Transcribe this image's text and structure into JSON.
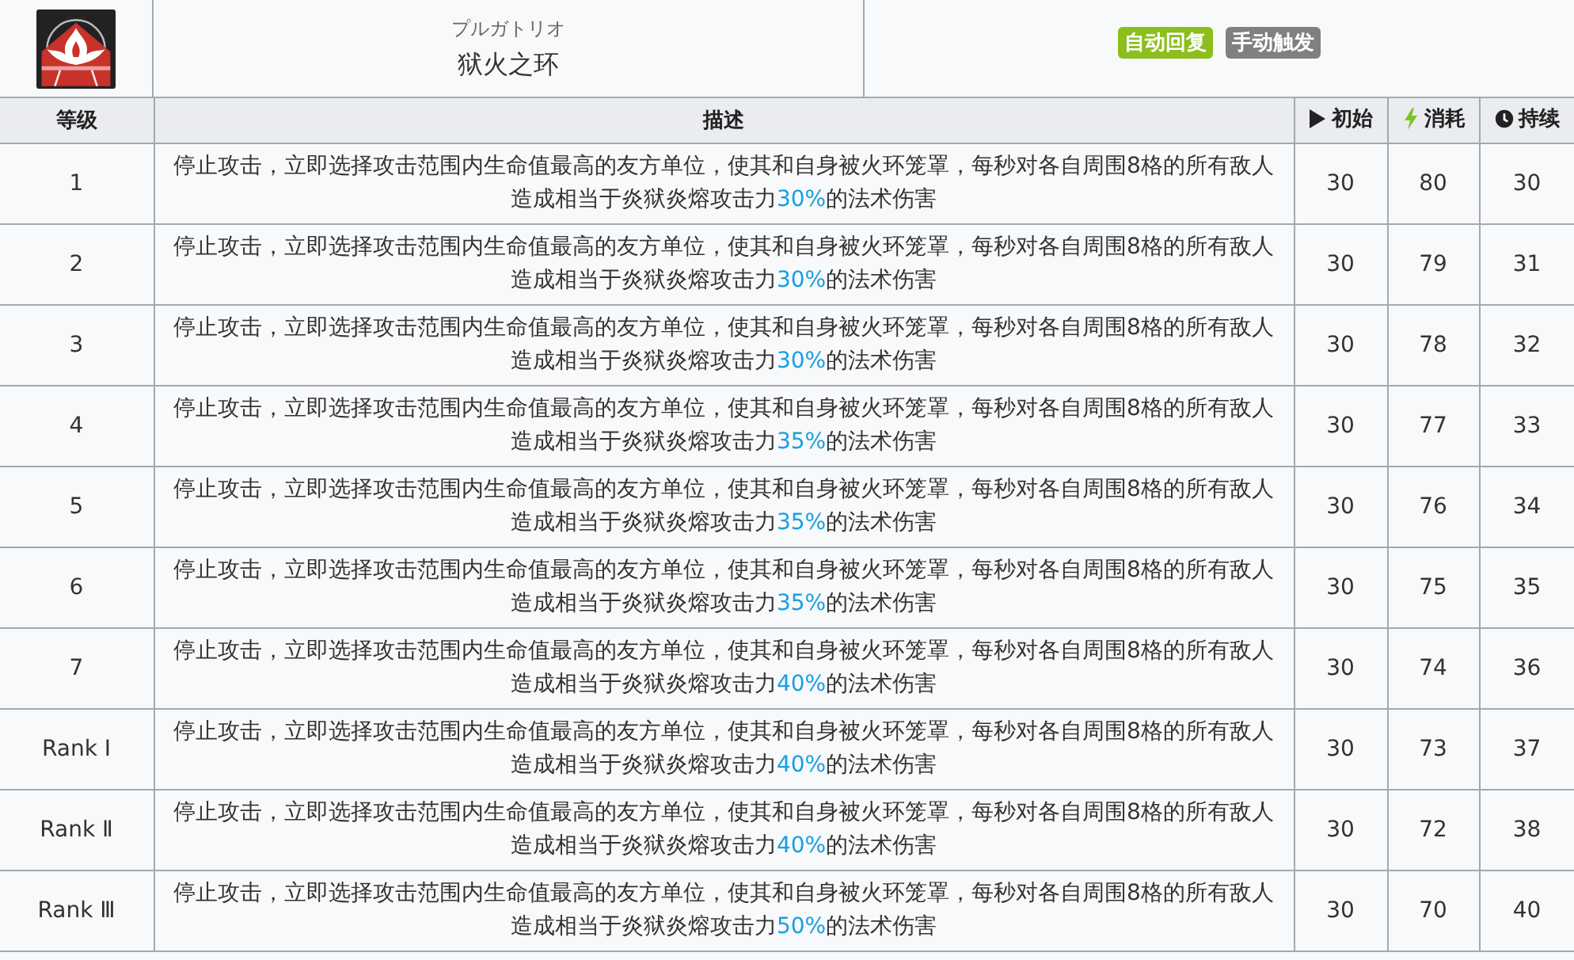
{
  "skill": {
    "subtitle": "プルガトリオ",
    "name": "狱火之环",
    "tags": [
      {
        "label": "自动回复",
        "color": "#8cbe1e"
      },
      {
        "label": "手动触发",
        "color": "#808080"
      }
    ]
  },
  "columns": [
    {
      "label": "等级"
    },
    {
      "label": "描述"
    },
    {
      "label": "初始"
    },
    {
      "label": "消耗"
    },
    {
      "label": "持续"
    }
  ],
  "rows": [
    {
      "level": "1",
      "desc": "停止攻击，立即选择攻击范围内生命值最高的友方单位，使其和自身被火环笼罩，每秒对各自周围8格的所有敌人造成相当于炎狱炎熔攻击力",
      "percent": "30%",
      "desc_end": "的法术伤害",
      "initial": "30",
      "cost": "80",
      "duration": "30"
    },
    {
      "level": "2",
      "desc": "停止攻击，立即选择攻击范围内生命值最高的友方单位，使其和自身被火环笼罩，每秒对各自周围8格的所有敌人造成相当于炎狱炎熔攻击力",
      "percent": "30%",
      "desc_end": "的法术伤害",
      "initial": "30",
      "cost": "79",
      "duration": "31"
    },
    {
      "level": "3",
      "desc": "停止攻击，立即选择攻击范围内生命值最高的友方单位，使其和自身被火环笼罩，每秒对各自周围8格的所有敌人造成相当于炎狱炎熔攻击力",
      "percent": "30%",
      "desc_end": "的法术伤害",
      "initial": "30",
      "cost": "78",
      "duration": "32"
    },
    {
      "level": "4",
      "desc": "停止攻击，立即选择攻击范围内生命值最高的友方单位，使其和自身被火环笼罩，每秒对各自周围8格的所有敌人造成相当于炎狱炎熔攻击力",
      "percent": "35%",
      "desc_end": "的法术伤害",
      "initial": "30",
      "cost": "77",
      "duration": "33"
    },
    {
      "level": "5",
      "desc": "停止攻击，立即选择攻击范围内生命值最高的友方单位，使其和自身被火环笼罩，每秒对各自周围8格的所有敌人造成相当于炎狱炎熔攻击力",
      "percent": "35%",
      "desc_end": "的法术伤害",
      "initial": "30",
      "cost": "76",
      "duration": "34"
    },
    {
      "level": "6",
      "desc": "停止攻击，立即选择攻击范围内生命值最高的友方单位，使其和自身被火环笼罩，每秒对各自周围8格的所有敌人造成相当于炎狱炎熔攻击力",
      "percent": "35%",
      "desc_end": "的法术伤害",
      "initial": "30",
      "cost": "75",
      "duration": "35"
    },
    {
      "level": "7",
      "desc": "停止攻击，立即选择攻击范围内生命值最高的友方单位，使其和自身被火环笼罩，每秒对各自周围8格的所有敌人造成相当于炎狱炎熔攻击力",
      "percent": "40%",
      "desc_end": "的法术伤害",
      "initial": "30",
      "cost": "74",
      "duration": "36"
    },
    {
      "level": "Rank Ⅰ",
      "desc": "停止攻击，立即选择攻击范围内生命值最高的友方单位，使其和自身被火环笼罩，每秒对各自周围8格的所有敌人造成相当于炎狱炎熔攻击力",
      "percent": "40%",
      "desc_end": "的法术伤害",
      "initial": "30",
      "cost": "73",
      "duration": "37"
    },
    {
      "level": "Rank Ⅱ",
      "desc": "停止攻击，立即选择攻击范围内生命值最高的友方单位，使其和自身被火环笼罩，每秒对各自周围8格的所有敌人造成相当于炎狱炎熔攻击力",
      "percent": "40%",
      "desc_end": "的法术伤害",
      "initial": "30",
      "cost": "72",
      "duration": "38"
    },
    {
      "level": "Rank Ⅲ",
      "desc": "停止攻击，立即选择攻击范围内生命值最高的友方单位，使其和自身被火环笼罩，每秒对各自周围8格的所有敌人造成相当于炎狱炎熔攻击力",
      "percent": "50%",
      "desc_end": "的法术伤害",
      "initial": "30",
      "cost": "70",
      "duration": "40"
    }
  ]
}
